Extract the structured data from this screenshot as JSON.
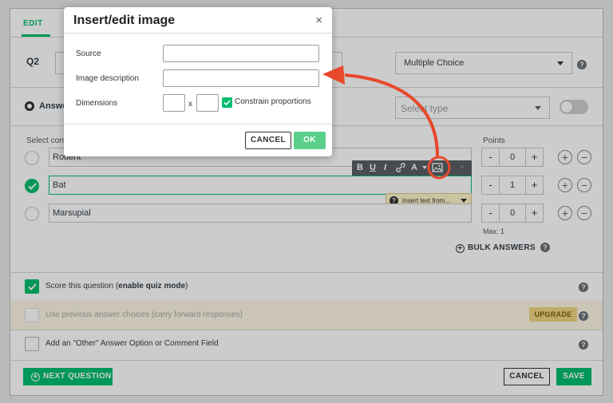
{
  "tabs": {
    "edit": "EDIT"
  },
  "question": {
    "number": "Q2",
    "type_value": "Multiple Choice",
    "answer_type_label": "Answe",
    "select_type_placeholder": "Select type",
    "select_correct_label": "Select corr",
    "points_label": "Points"
  },
  "answers": [
    {
      "text": "Rodent",
      "points": "0",
      "correct": false
    },
    {
      "text": "Bat",
      "points": "1",
      "correct": true
    },
    {
      "text": "Marsupial",
      "points": "0",
      "correct": false
    }
  ],
  "editor_toolbar": {
    "bold": "B",
    "underline": "U",
    "italic": "I",
    "font_color": "A"
  },
  "insert_text_hint": "Insert text from...",
  "max_points": "Max: 1",
  "bulk_answers": "BULK ANSWERS",
  "options": {
    "score_prefix": "Score this question (",
    "score_bold": "enable quiz mode",
    "score_suffix": ")",
    "carry_prefix": "Use previous answer choices (",
    "carry_bold": "carry forward responses",
    "carry_suffix": ")",
    "upgrade": "UPGRADE",
    "other_label": "Add an \"Other\" Answer Option or Comment Field"
  },
  "footer": {
    "next_question": "NEXT QUESTION",
    "cancel": "CANCEL",
    "save": "SAVE"
  },
  "dialog": {
    "title": "Insert/edit image",
    "close_glyph": "×",
    "source_label": "Source",
    "source_value": "",
    "description_label": "Image description",
    "description_value": "",
    "dimensions_label": "Dimensions",
    "dimension_separator": "x",
    "constrain_label": "Constrain proportions",
    "constrain_checked": true,
    "cancel": "CANCEL",
    "ok": "OK"
  },
  "colors": {
    "brand_green": "#00bf6f",
    "annotation_red": "#e8482c",
    "upgrade_bg": "#f2d682"
  },
  "icons": [
    "close-icon",
    "chevron-down-icon",
    "help-icon",
    "check-icon",
    "plus-circle-icon",
    "minus-circle-icon",
    "link-icon",
    "image-icon",
    "arrow-annotation"
  ]
}
